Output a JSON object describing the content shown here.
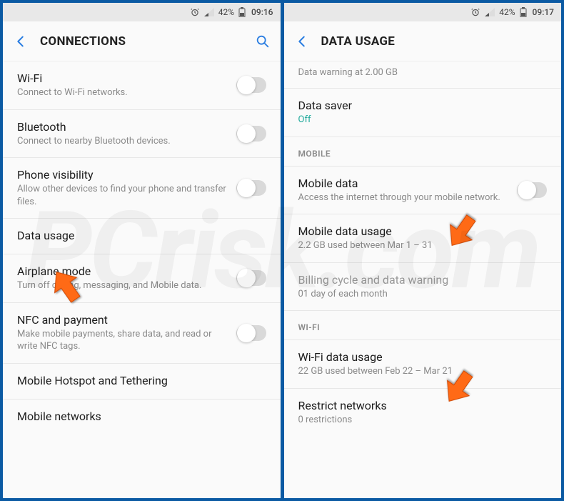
{
  "status": {
    "battery_pct_left": "42%",
    "time_left": "09:16",
    "battery_pct_right": "42%",
    "time_right": "09:17"
  },
  "left": {
    "title": "CONNECTIONS",
    "items": [
      {
        "title": "Wi-Fi",
        "sub": "Connect to Wi-Fi networks.",
        "toggle": true
      },
      {
        "title": "Bluetooth",
        "sub": "Connect to nearby Bluetooth devices.",
        "toggle": true
      },
      {
        "title": "Phone visibility",
        "sub": "Allow other devices to find your phone and transfer files.",
        "toggle": true
      },
      {
        "title": "Data usage",
        "sub": "",
        "toggle": false
      },
      {
        "title": "Airplane mode",
        "sub": "Turn off calling, messaging, and Mobile data.",
        "toggle": true
      },
      {
        "title": "NFC and payment",
        "sub": "Make mobile payments, share data, and read or write NFC tags.",
        "toggle": true
      },
      {
        "title": "Mobile Hotspot and Tethering",
        "sub": "",
        "toggle": false
      },
      {
        "title": "Mobile networks",
        "sub": "",
        "toggle": false
      }
    ]
  },
  "right": {
    "title": "DATA USAGE",
    "warning": "Data warning at 2.00 GB",
    "data_saver": {
      "title": "Data saver",
      "sub": "Off"
    },
    "section_mobile": "MOBILE",
    "mobile_data": {
      "title": "Mobile data",
      "sub": "Access the internet through your mobile network."
    },
    "mobile_usage": {
      "title": "Mobile data usage",
      "sub": "2.2 GB used between Mar 1 – 31"
    },
    "billing": {
      "title": "Billing cycle and data warning",
      "sub": "01 day of each month"
    },
    "section_wifi": "WI-FI",
    "wifi_usage": {
      "title": "Wi-Fi data usage",
      "sub": "22 GB used between Feb 22 – Mar 21"
    },
    "restrict": {
      "title": "Restrict networks",
      "sub": "0 restrictions"
    }
  },
  "watermark": "PCrisk.com"
}
